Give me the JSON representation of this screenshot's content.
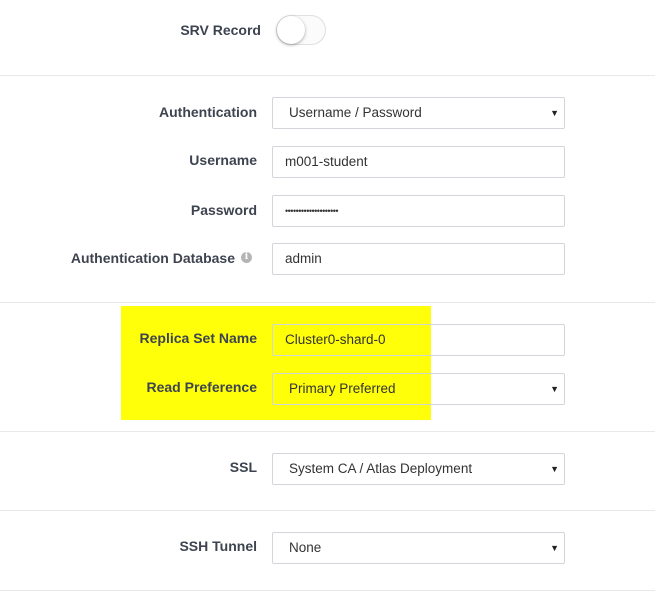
{
  "srv": {
    "label": "SRV Record",
    "enabled": false
  },
  "auth": {
    "authentication_label": "Authentication",
    "authentication_value": "Username / Password",
    "username_label": "Username",
    "username_value": "m001-student",
    "password_label": "Password",
    "password_value": "••••••••••••••••••••",
    "auth_db_label": "Authentication Database",
    "auth_db_info_icon": "i",
    "auth_db_value": "admin"
  },
  "replica": {
    "name_label": "Replica Set Name",
    "name_value": "Cluster0-shard-0",
    "read_pref_label": "Read Preference",
    "read_pref_value": "Primary Preferred"
  },
  "ssl": {
    "label": "SSL",
    "value": "System CA / Atlas Deployment"
  },
  "ssh": {
    "label": "SSH Tunnel",
    "value": "None"
  },
  "icons": {
    "caret": "▼",
    "highlight_color": "#ffff0a"
  }
}
